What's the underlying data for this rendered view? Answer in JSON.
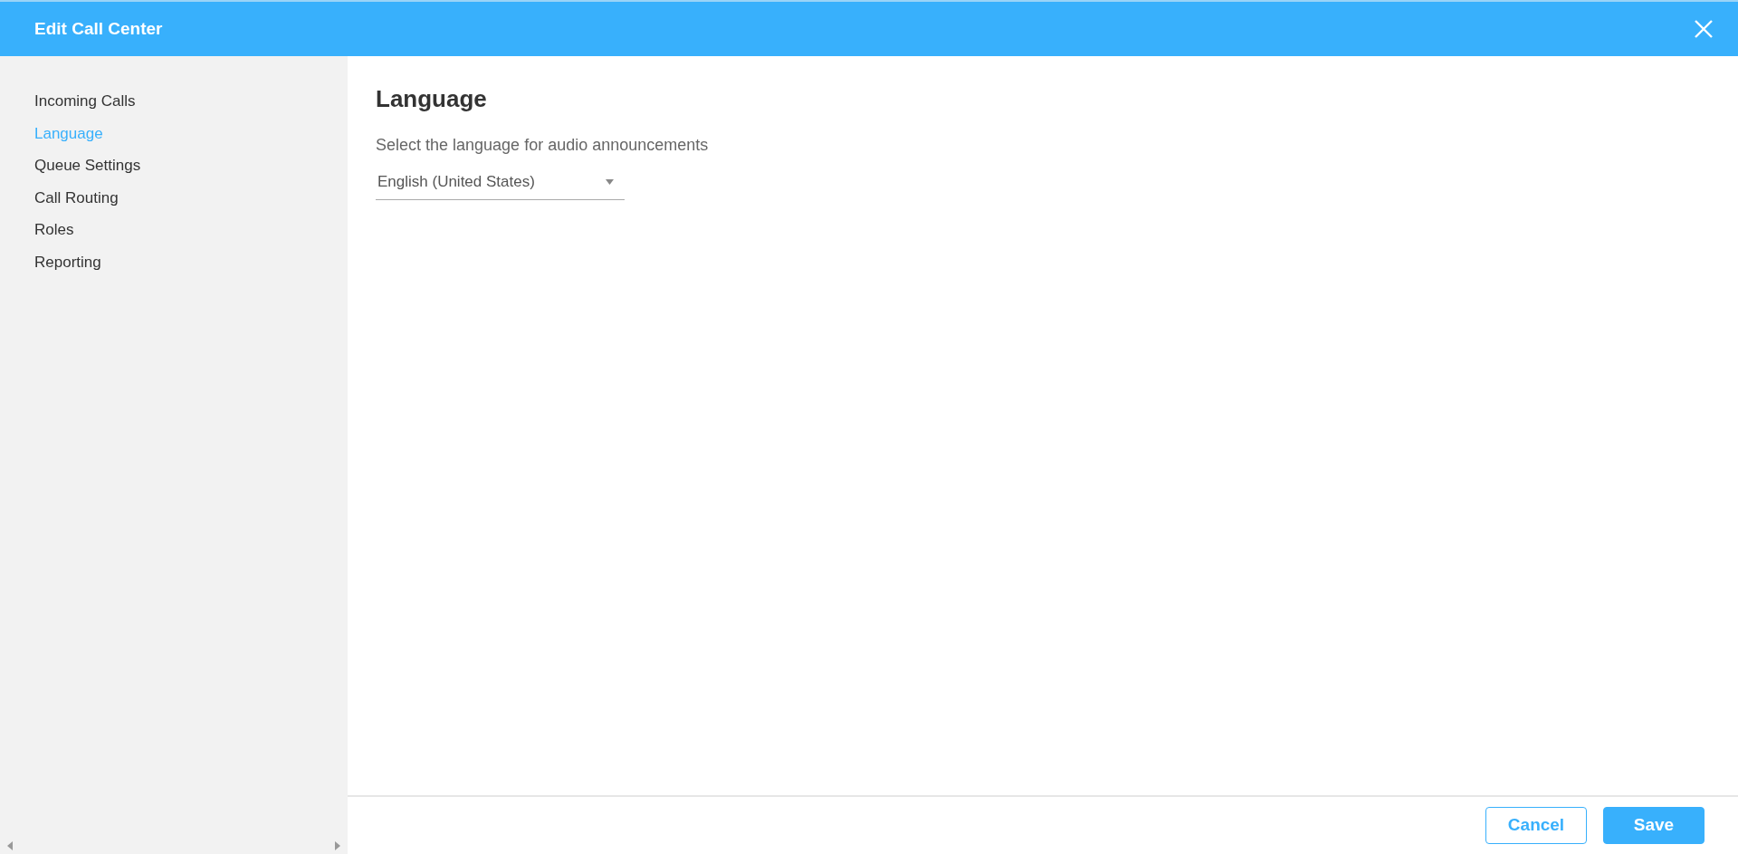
{
  "window": {
    "title": "Edit Call Center"
  },
  "sidebar": {
    "items": [
      {
        "label": "Incoming Calls",
        "selected": false
      },
      {
        "label": "Language",
        "selected": true
      },
      {
        "label": "Queue Settings",
        "selected": false
      },
      {
        "label": "Call Routing",
        "selected": false
      },
      {
        "label": "Roles",
        "selected": false
      },
      {
        "label": "Reporting",
        "selected": false
      }
    ]
  },
  "content": {
    "heading": "Language",
    "description": "Select the language for audio announcements",
    "language_select": {
      "value": "English (United States)"
    }
  },
  "buttons": [
    {
      "label": "Cancel",
      "kind": "secondary"
    },
    {
      "label": "Save",
      "kind": "primary"
    }
  ]
}
